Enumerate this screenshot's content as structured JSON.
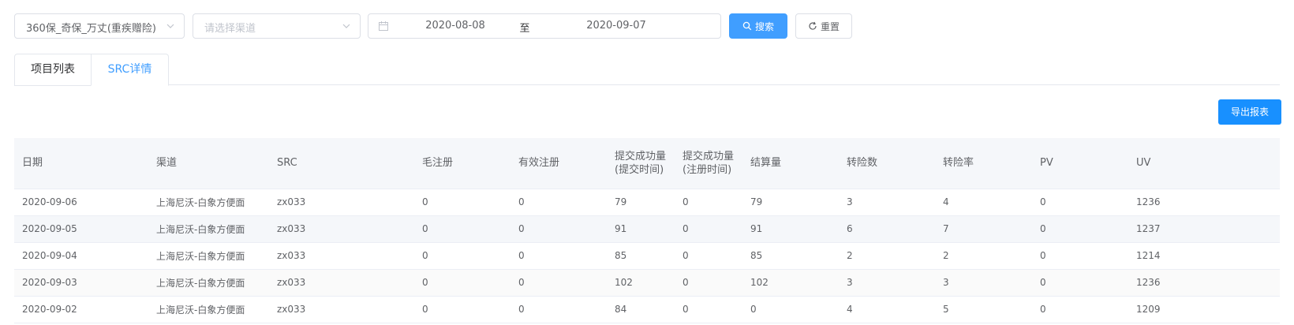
{
  "filters": {
    "product": "360保_奇保_万丈(重疾赠险)",
    "channel_placeholder": "请选择渠道",
    "date_start": "2020-08-08",
    "date_separator": "至",
    "date_end": "2020-09-07",
    "search_label": "搜索",
    "reset_label": "重置"
  },
  "tabs": [
    {
      "label": "项目列表",
      "active": false
    },
    {
      "label": "SRC详情",
      "active": true
    }
  ],
  "export_label": "导出报表",
  "table": {
    "headers": [
      "日期",
      "渠道",
      "SRC",
      "毛注册",
      "有效注册",
      "提交成功量(提交时间)",
      "提交成功量(注册时间)",
      "结算量",
      "转险数",
      "转险率",
      "PV",
      "UV"
    ],
    "header_lines": [
      [
        "日期"
      ],
      [
        "渠道"
      ],
      [
        "SRC"
      ],
      [
        "毛注册"
      ],
      [
        "有效注册"
      ],
      [
        "提交成功量",
        "(提交时间)"
      ],
      [
        "提交成功量",
        "(注册时间)"
      ],
      [
        "结算量"
      ],
      [
        "转险数"
      ],
      [
        "转险率"
      ],
      [
        "PV"
      ],
      [
        "UV"
      ]
    ],
    "rows": [
      [
        "2020-09-06",
        "上海尼沃-白象方便面",
        "zx033",
        "0",
        "0",
        "79",
        "0",
        "79",
        "3",
        "4",
        "0",
        "1236"
      ],
      [
        "2020-09-05",
        "上海尼沃-白象方便面",
        "zx033",
        "0",
        "0",
        "91",
        "0",
        "91",
        "6",
        "7",
        "0",
        "1237"
      ],
      [
        "2020-09-04",
        "上海尼沃-白象方便面",
        "zx033",
        "0",
        "0",
        "85",
        "0",
        "85",
        "2",
        "2",
        "0",
        "1214"
      ],
      [
        "2020-09-03",
        "上海尼沃-白象方便面",
        "zx033",
        "0",
        "0",
        "102",
        "0",
        "102",
        "3",
        "3",
        "0",
        "1236"
      ],
      [
        "2020-09-02",
        "上海尼沃-白象方便面",
        "zx033",
        "0",
        "0",
        "84",
        "0",
        "0",
        "4",
        "5",
        "0",
        "1209"
      ]
    ]
  },
  "colors": {
    "primary": "#409eff",
    "export": "#1890ff",
    "header_bg": "#f5f7fa"
  }
}
